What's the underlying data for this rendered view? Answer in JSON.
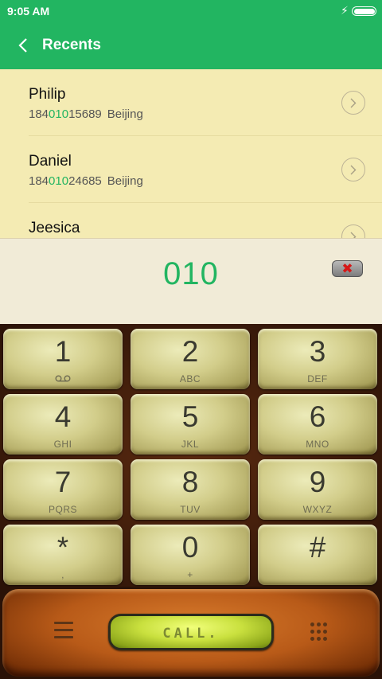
{
  "status_bar": {
    "time": "9:05 AM"
  },
  "app_bar": {
    "title": "Recents"
  },
  "recents": [
    {
      "name": "Philip",
      "number_prefix": "184",
      "number_match": "010",
      "number_suffix": "15689",
      "location": "Beijing"
    },
    {
      "name": "Daniel",
      "number_prefix": "184",
      "number_match": "010",
      "number_suffix": "24685",
      "location": "Beijing"
    },
    {
      "name": "Jeesica",
      "number_prefix": "",
      "number_match": "",
      "number_suffix": "",
      "location": ""
    }
  ],
  "dialer": {
    "typed_number": "010"
  },
  "keys": [
    {
      "digit": "1",
      "letters": ""
    },
    {
      "digit": "2",
      "letters": "ABC"
    },
    {
      "digit": "3",
      "letters": "DEF"
    },
    {
      "digit": "4",
      "letters": "GHI"
    },
    {
      "digit": "5",
      "letters": "JKL"
    },
    {
      "digit": "6",
      "letters": "MNO"
    },
    {
      "digit": "7",
      "letters": "PQRS"
    },
    {
      "digit": "8",
      "letters": "TUV"
    },
    {
      "digit": "9",
      "letters": "WXYZ"
    },
    {
      "digit": "*",
      "letters": ","
    },
    {
      "digit": "0",
      "letters": "+"
    },
    {
      "digit": "#",
      "letters": ""
    }
  ],
  "bottom_bar": {
    "call_label": "CALL."
  },
  "colors": {
    "accent": "#22b561",
    "list_background": "#f4ebb3",
    "display_background": "#f1ebd7"
  },
  "icons": {
    "back": "chevron-left-icon",
    "row_action": "chevron-right-circle-icon",
    "delete": "backspace-x-icon",
    "voicemail": "voicemail-icon",
    "menu": "menu-icon",
    "dialpad": "dialpad-icon"
  }
}
